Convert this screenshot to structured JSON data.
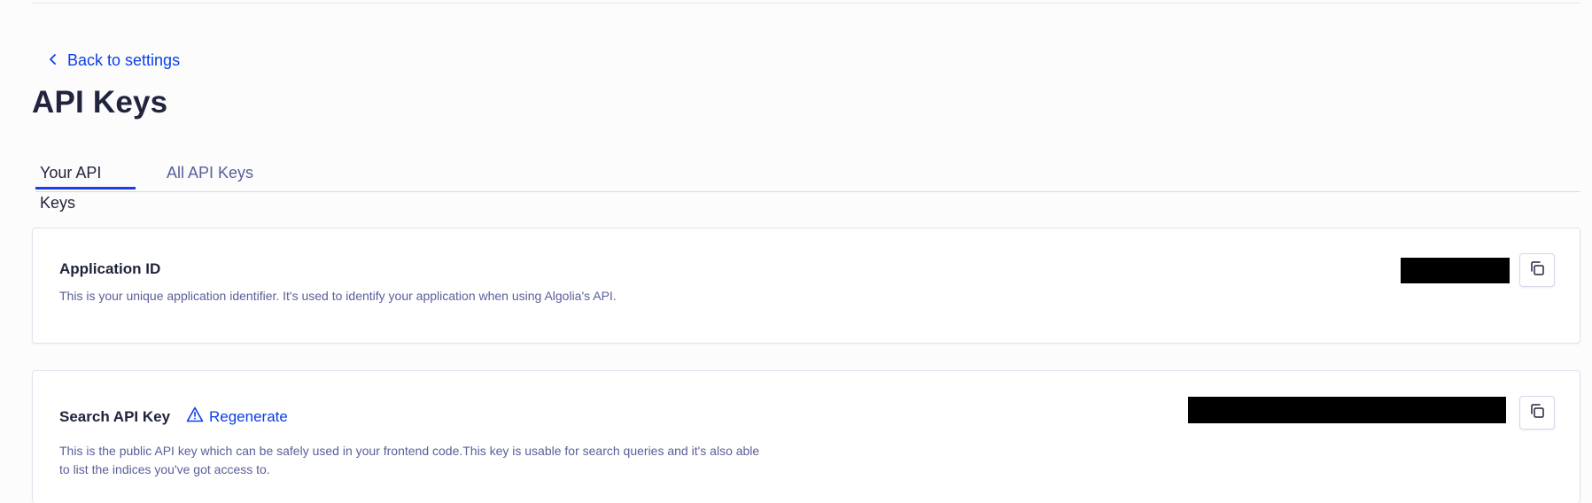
{
  "nav": {
    "back_label": "Back to settings"
  },
  "page": {
    "title": "API Keys"
  },
  "tabs": [
    {
      "label": "Your API Keys",
      "active": true
    },
    {
      "label": "All API Keys",
      "active": false
    }
  ],
  "cards": {
    "application_id": {
      "title": "Application ID",
      "description": "This is your unique application identifier. It's used to identify your application when using Algolia's API.",
      "value": "",
      "copy_icon": "copy-icon"
    },
    "search_api_key": {
      "title": "Search API Key",
      "regenerate_label": "Regenerate",
      "regenerate_icon": "warning-icon",
      "description_line1": "This is the public API key which can be safely used in your frontend code.This key is usable for search queries and it's also able",
      "description_line2": "to list the indices you've got access to.",
      "value": "",
      "copy_icon": "copy-icon"
    }
  },
  "colors": {
    "accent": "#0b3ee8",
    "tab_indicator": "#1d3ee6",
    "text_primary": "#21243d",
    "text_secondary": "#5a5e9a",
    "background": "#fcfcfd"
  }
}
